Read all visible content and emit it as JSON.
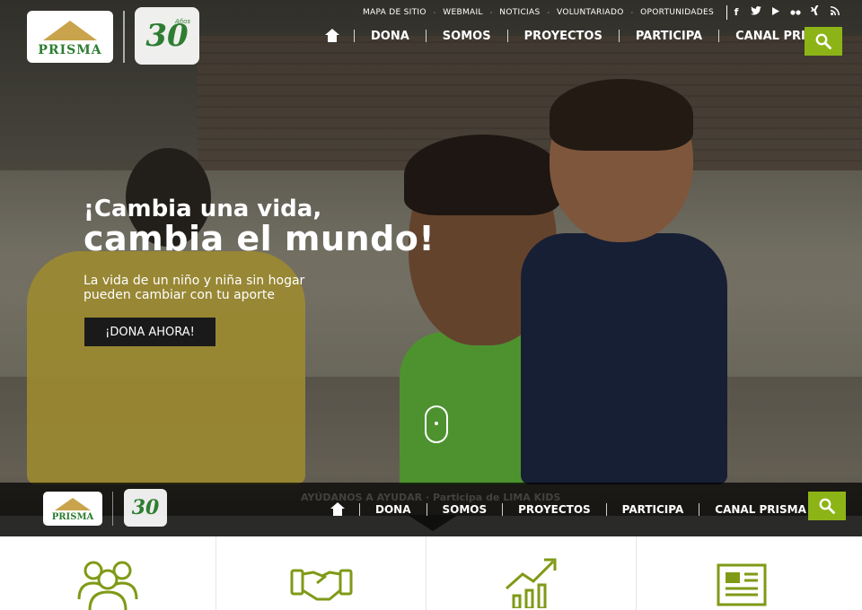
{
  "brand": {
    "logo_text": "PRISMA",
    "anniversary_number": "30",
    "anniversary_label": "Años"
  },
  "utility_links": [
    "MAPA DE SITIO",
    "WEBMAIL",
    "NOTICIAS",
    "VOLUNTARIADO",
    "OPORTUNIDADES"
  ],
  "social_icons": [
    "facebook-icon",
    "twitter-icon",
    "youtube-icon",
    "flickr-icon",
    "xing-icon",
    "rss-icon"
  ],
  "nav": {
    "items": [
      "DONA",
      "SOMOS",
      "PROYECTOS",
      "PARTICIPA",
      "CANAL PRISMA"
    ]
  },
  "hero": {
    "headline_line1": "¡Cambia una vida,",
    "headline_line2": "cambia el mundo!",
    "subtext": "La vida de un niño y niña sin hogar pueden cambiar con tu aporte",
    "cta_label": "¡DONA AHORA!"
  },
  "sticky_nav": {
    "items": [
      "DONA",
      "SOMOS",
      "PROYECTOS",
      "PARTICIPA",
      "CANAL PRISMA"
    ],
    "behind_text": "AYÚDANOS A AYUDAR · Participa de LIMA KIDS"
  },
  "tiles": [
    "people-icon",
    "handshake-icon",
    "growth-chart-icon",
    "newspaper-icon"
  ],
  "colors": {
    "accent": "#8db417",
    "icon": "#7f9a16",
    "logo_green": "#2e7d32",
    "logo_gold": "#c9a44c"
  }
}
